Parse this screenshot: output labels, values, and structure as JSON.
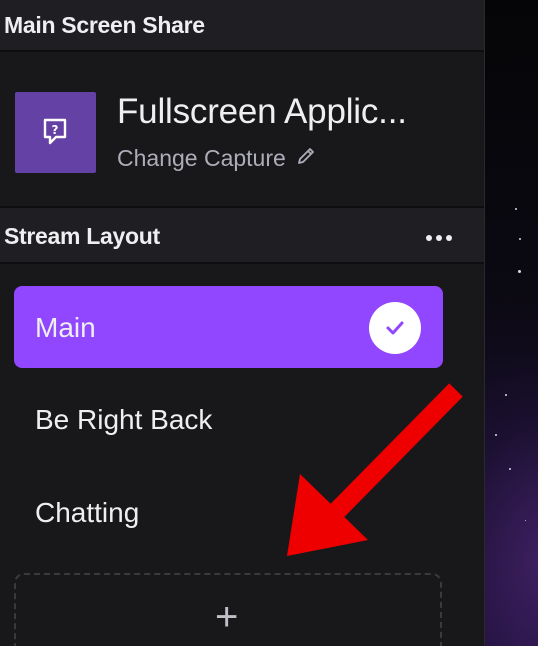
{
  "main_screen_share": {
    "title": "Main Screen Share",
    "capture_name": "Fullscreen Applic...",
    "change_capture_label": "Change Capture"
  },
  "stream_layout": {
    "title": "Stream Layout",
    "items": [
      {
        "label": "Main",
        "selected": true
      },
      {
        "label": "Be Right Back",
        "selected": false
      },
      {
        "label": "Chatting",
        "selected": false
      }
    ],
    "add_label": "+"
  },
  "colors": {
    "accent": "#9147ff",
    "capture_thumb": "#6441a5",
    "annotation_arrow": "#ee0000"
  },
  "icons": {
    "capture": "question-bubble-icon",
    "edit": "pencil-icon",
    "more": "more-options-icon",
    "selected": "checkmark-icon",
    "annotation": "red-arrow-annotation"
  }
}
